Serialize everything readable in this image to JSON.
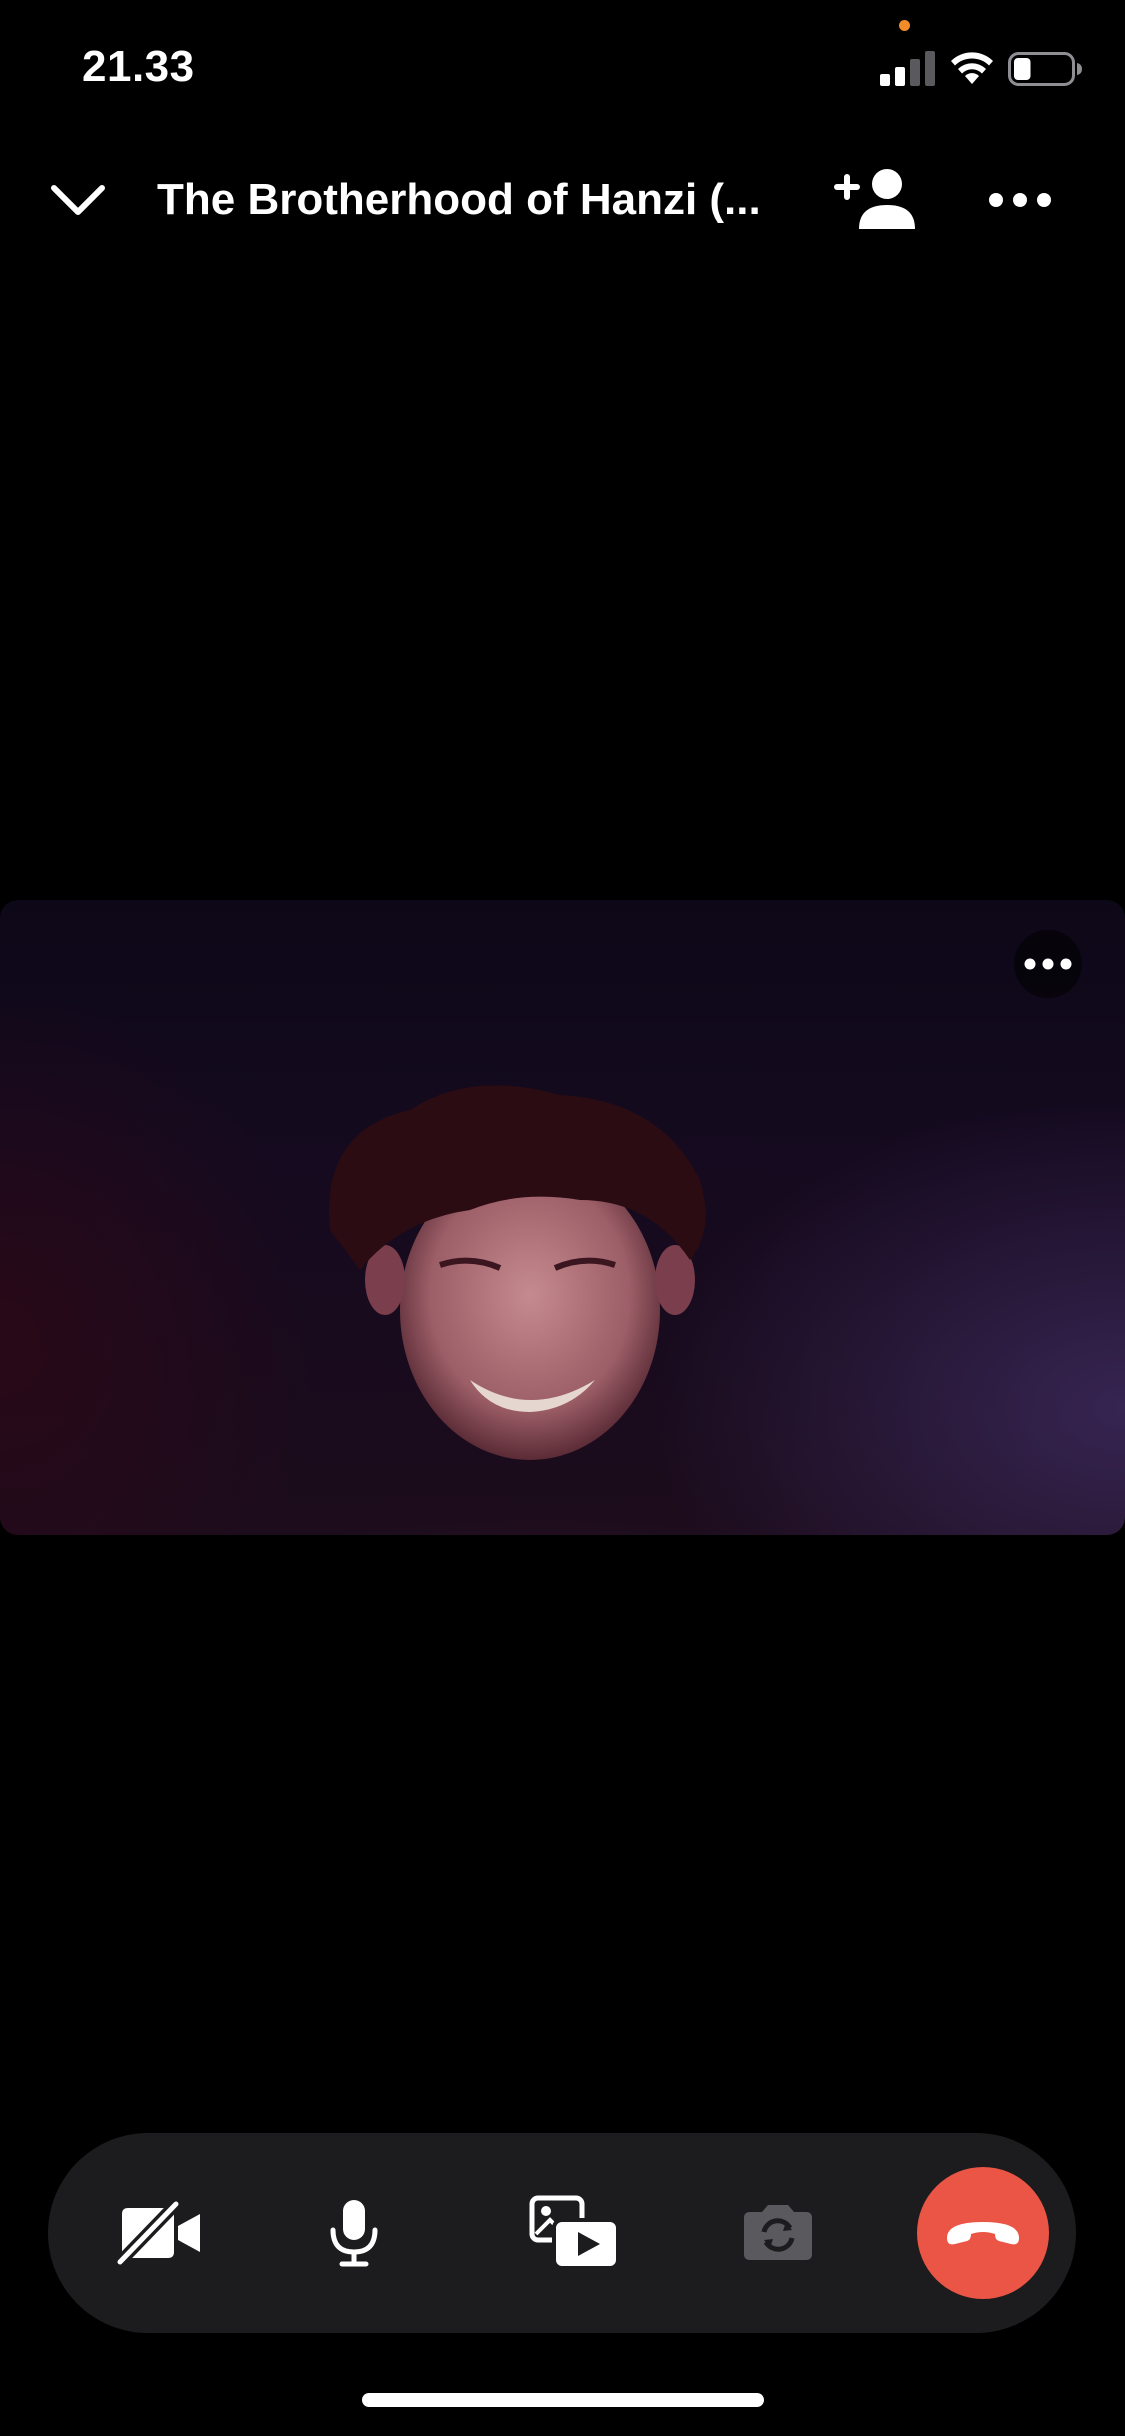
{
  "status_bar": {
    "time": "21.33",
    "privacy_indicator_color": "#f28c28",
    "signal_icon": "cellular-signal-icon",
    "wifi_icon": "wifi-icon",
    "battery_icon": "battery-icon",
    "battery_level": 0.3
  },
  "header": {
    "title": "The Brotherhood of Hanzi (...",
    "collapse_icon": "chevron-down-icon",
    "add_person_icon": "add-person-icon",
    "more_icon": "more-dots-icon"
  },
  "video_tile": {
    "more_icon": "more-dots-icon"
  },
  "controls": {
    "camera_icon": "video-off-icon",
    "mic_icon": "microphone-icon",
    "share_icon": "share-media-icon",
    "flip_icon": "flip-camera-icon",
    "flip_disabled": true,
    "end_call_icon": "hang-up-icon",
    "end_call_color": "#eb5545"
  },
  "colors": {
    "background": "#000000",
    "control_bar": "#1c1c1e",
    "icon": "#ffffff",
    "disabled_icon": "#5a5a5e"
  }
}
